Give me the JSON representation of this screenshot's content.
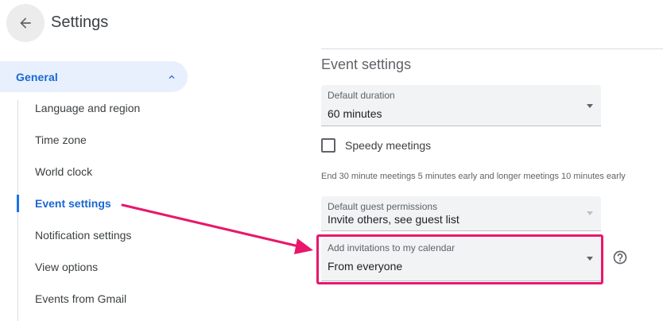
{
  "header": {
    "title": "Settings",
    "back_icon": "arrow-back-icon"
  },
  "sidebar": {
    "section_label": "General",
    "items": [
      {
        "label": "Language and region"
      },
      {
        "label": "Time zone"
      },
      {
        "label": "World clock"
      },
      {
        "label": "Event settings",
        "active": true
      },
      {
        "label": "Notification settings"
      },
      {
        "label": "View options"
      },
      {
        "label": "Events from Gmail"
      }
    ]
  },
  "main": {
    "section_title": "Event settings",
    "default_duration": {
      "label": "Default duration",
      "value": "60 minutes"
    },
    "speedy_meetings": {
      "label": "Speedy meetings",
      "checked": false,
      "helper": "End 30 minute meetings 5 minutes early and longer meetings 10 minutes early"
    },
    "guest_permissions": {
      "label": "Default guest permissions",
      "value": "Invite others, see guest list"
    },
    "add_invitations": {
      "label": "Add invitations to my calendar",
      "value": "From everyone"
    }
  },
  "colors": {
    "accent": "#1967d2",
    "annotation": "#e8176b"
  }
}
